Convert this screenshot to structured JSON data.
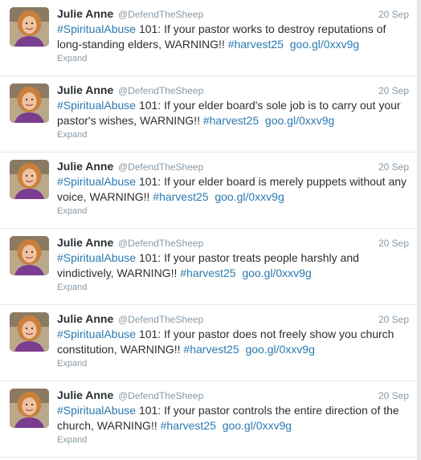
{
  "tweets": [
    {
      "name": "Julie Anne",
      "handle": "@DefendTheSheep",
      "date": "20 Sep",
      "tag": "#SpiritualAbuse",
      "body": " 101: If your pastor works to destroy reputations of long-standing elders, WARNING!! ",
      "hashtag": "#harvest25",
      "link": "goo.gl/0xxv9g",
      "expand": "Expand"
    },
    {
      "name": "Julie Anne",
      "handle": "@DefendTheSheep",
      "date": "20 Sep",
      "tag": "#SpiritualAbuse",
      "body": " 101: If your elder board's sole job is to carry out your pastor's wishes, WARNING!! ",
      "hashtag": "#harvest25",
      "link": "goo.gl/0xxv9g",
      "expand": "Expand"
    },
    {
      "name": "Julie Anne",
      "handle": "@DefendTheSheep",
      "date": "20 Sep",
      "tag": "#SpiritualAbuse",
      "body": " 101: If your elder board is merely puppets without any voice, WARNING!! ",
      "hashtag": "#harvest25",
      "link": "goo.gl/0xxv9g",
      "expand": "Expand"
    },
    {
      "name": "Julie Anne",
      "handle": "@DefendTheSheep",
      "date": "20 Sep",
      "tag": "#SpiritualAbuse",
      "body": " 101: If your pastor treats people harshly and vindictively, WARNING!! ",
      "hashtag": "#harvest25",
      "link": "goo.gl/0xxv9g",
      "expand": "Expand"
    },
    {
      "name": "Julie Anne",
      "handle": "@DefendTheSheep",
      "date": "20 Sep",
      "tag": "#SpiritualAbuse",
      "body": " 101: If your pastor does not freely show you church constitution, WARNING!! ",
      "hashtag": "#harvest25",
      "link": "goo.gl/0xxv9g",
      "expand": "Expand"
    },
    {
      "name": "Julie Anne",
      "handle": "@DefendTheSheep",
      "date": "20 Sep",
      "tag": "#SpiritualAbuse",
      "body": " 101: If your pastor controls the entire direction of the church, WARNING!! ",
      "hashtag": "#harvest25",
      "link": "goo.gl/0xxv9g",
      "expand": "Expand"
    }
  ],
  "colors": {
    "link": "#2a7ab0",
    "muted": "#8899a6",
    "text": "#292f33"
  }
}
